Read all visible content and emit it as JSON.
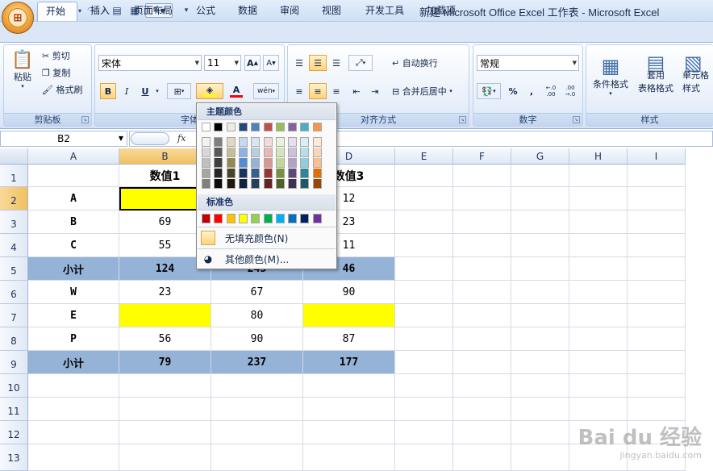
{
  "window": {
    "title": "新建 Microsoft Office Excel 工作表 - Microsoft Excel"
  },
  "tabs": [
    "开始",
    "插入",
    "页面布局",
    "公式",
    "数据",
    "审阅",
    "视图",
    "开发工具",
    "加载项"
  ],
  "clipboard": {
    "paste": "粘贴",
    "cut": "剪切",
    "copy": "复制",
    "format_painter": "格式刷",
    "label": "剪贴板"
  },
  "font": {
    "name": "宋体",
    "size": "11",
    "bold": "B",
    "italic": "I",
    "underline": "U",
    "label": "字体",
    "phonetic": "wén"
  },
  "alignment": {
    "wrap_text": "自动换行",
    "merge_center": "合并后居中",
    "label": "对齐方式"
  },
  "number": {
    "format": "常规",
    "percent": "%",
    "comma": ",",
    "inc_decimal": "←.0 .00",
    "dec_decimal": ".00 →.0",
    "label": "数字"
  },
  "styles": {
    "conditional": "条件格式",
    "table_line1": "套用",
    "table_line2": "表格格式",
    "cell_line1": "单元格",
    "cell_line2": "样式",
    "label": "样式"
  },
  "formula_bar": {
    "name_box": "B2",
    "fx": "fx"
  },
  "columns": [
    "A",
    "B",
    "C",
    "D",
    "E",
    "F",
    "G",
    "H",
    "I"
  ],
  "rows": [
    "1",
    "2",
    "3",
    "4",
    "5",
    "6",
    "7",
    "8",
    "9",
    "10",
    "11",
    "12",
    "13"
  ],
  "cells": {
    "b1": "数值1",
    "c1": "数值2",
    "d1": "数值3",
    "a2": "A",
    "b2": "",
    "c2": "",
    "d2": "12",
    "a3": "B",
    "b3": "69",
    "c3": "",
    "d3": "23",
    "a4": "C",
    "b4": "55",
    "c4": "",
    "d4": "11",
    "a5": "小计",
    "b5": "124",
    "c5": "243",
    "d5": "46",
    "a6": "W",
    "b6": "23",
    "c6": "67",
    "d6": "90",
    "a7": "E",
    "b7": "",
    "c7": "80",
    "d7": "",
    "a8": "P",
    "b8": "56",
    "c8": "90",
    "d8": "87",
    "a9": "小计",
    "b9": "79",
    "c9": "237",
    "d9": "177"
  },
  "palette": {
    "theme_title": "主题颜色",
    "standard_title": "标准色",
    "no_fill": "无填充颜色(N)",
    "more_colors": "其他颜色(M)...",
    "theme_top": [
      "#ffffff",
      "#000000",
      "#eeece1",
      "#1f497d",
      "#4f81bd",
      "#c0504d",
      "#9bbb59",
      "#8064a2",
      "#4bacc6",
      "#f79646"
    ],
    "theme_shades": [
      [
        "#f2f2f2",
        "#7f7f7f",
        "#ddd9c3",
        "#c6d9f0",
        "#dbe5f1",
        "#f2dcdb",
        "#ebf1dd",
        "#e5e0ec",
        "#dbeef3",
        "#fdeada"
      ],
      [
        "#d8d8d8",
        "#595959",
        "#c4bd97",
        "#8db3e2",
        "#b8cce4",
        "#e5b9b7",
        "#d7e3bc",
        "#ccc1d9",
        "#b7dde8",
        "#fbd5b5"
      ],
      [
        "#bfbfbf",
        "#3f3f3f",
        "#938953",
        "#548dd4",
        "#95b3d7",
        "#d99694",
        "#c3d69b",
        "#b2a2c7",
        "#92cddc",
        "#fac08f"
      ],
      [
        "#a5a5a5",
        "#262626",
        "#494429",
        "#17365d",
        "#366092",
        "#953734",
        "#76923c",
        "#5f497a",
        "#31859b",
        "#e36c09"
      ],
      [
        "#7f7f7f",
        "#0c0c0c",
        "#1d1b10",
        "#0f243e",
        "#244061",
        "#632423",
        "#4f6128",
        "#3f3151",
        "#205867",
        "#974806"
      ]
    ],
    "standard": [
      "#c00000",
      "#ff0000",
      "#ffc000",
      "#ffff00",
      "#92d050",
      "#00b050",
      "#00b0f0",
      "#0070c0",
      "#002060",
      "#7030a0"
    ]
  },
  "watermark": {
    "brand": "Bai du 经验",
    "url": "jingyan.baidu.com"
  }
}
